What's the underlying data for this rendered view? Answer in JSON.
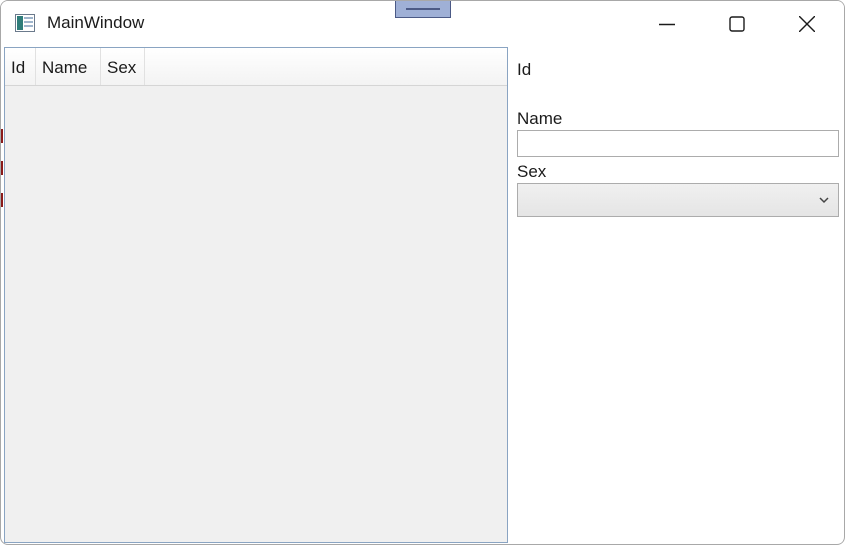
{
  "window": {
    "title": "MainWindow"
  },
  "icons": {
    "app": "app-window-icon",
    "minimize": "minimize-icon",
    "maximize": "maximize-icon",
    "close": "close-icon",
    "dropdown": "chevron-down-icon",
    "drag": "drag-handle-icon"
  },
  "list": {
    "columns": [
      "Id",
      "Name",
      "Sex"
    ],
    "rows": []
  },
  "detail": {
    "id_label": "Id",
    "name_label": "Name",
    "name_value": "",
    "sex_label": "Sex",
    "sex_value": ""
  },
  "colors": {
    "list_background": "#f0f0f0",
    "list_border": "#8aa4c2",
    "drag_handle": "#9fb0d6"
  }
}
